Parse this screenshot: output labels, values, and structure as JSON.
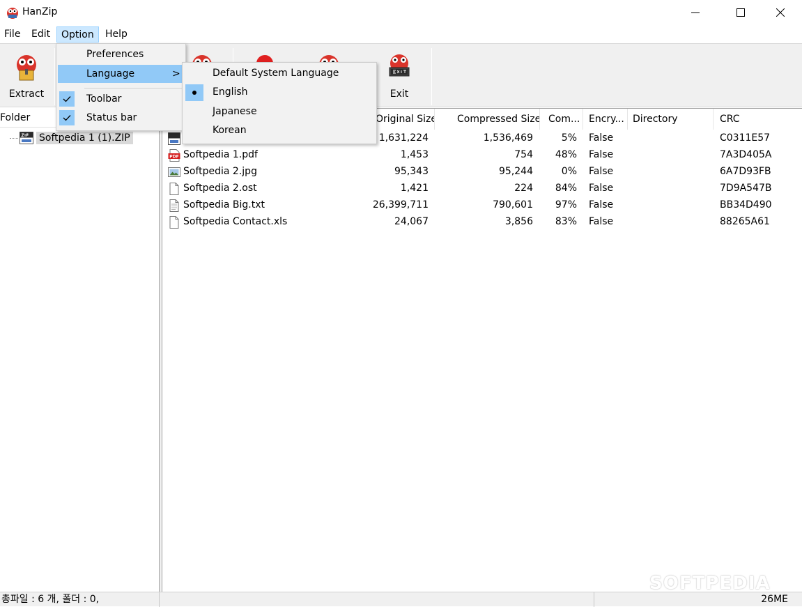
{
  "window": {
    "title": "HanZip",
    "minimize_glyph": "—",
    "maximize_glyph": "☐",
    "close_glyph": "✕"
  },
  "menubar": {
    "items": [
      {
        "label": "File"
      },
      {
        "label": "Edit"
      },
      {
        "label": "Option"
      },
      {
        "label": "Help"
      }
    ]
  },
  "toolbar": {
    "buttons": [
      {
        "label": "Extract",
        "icon": "extract-mascot-icon"
      },
      {
        "label": "",
        "icon": "mascot-icon"
      },
      {
        "label": "",
        "icon": "red-stop-icon"
      },
      {
        "label": "",
        "icon": "mascot-icon"
      },
      {
        "label": "Exit",
        "icon": "exit-mascot-icon"
      }
    ]
  },
  "option_menu": {
    "items": [
      {
        "label": "Preferences",
        "checked": false,
        "submenu": false
      },
      {
        "label": "Language",
        "checked": false,
        "submenu": true,
        "arrow": ">"
      },
      {
        "label": "Toolbar",
        "checked": true
      },
      {
        "label": "Status bar",
        "checked": true
      }
    ]
  },
  "language_submenu": {
    "items": [
      {
        "label": "Default System Language",
        "selected": false
      },
      {
        "label": "English",
        "selected": true
      },
      {
        "label": "Japanese",
        "selected": false
      },
      {
        "label": "Korean",
        "selected": false
      }
    ]
  },
  "left_panel": {
    "header": "Folder",
    "tree_item": "Softpedia 1 (1).ZIP"
  },
  "file_list": {
    "columns": [
      "Original Size",
      "Compressed Size",
      "Com...",
      "Encry...",
      "Directory",
      "CRC"
    ],
    "rows": [
      {
        "name": "",
        "icon": "zip-file-icon",
        "original": "1,631,224",
        "compressed": "1,536,469",
        "ratio": "5%",
        "encrypted": "False",
        "directory": "",
        "crc": "C0311E57"
      },
      {
        "name": "Softpedia 1.pdf",
        "icon": "pdf-file-icon",
        "original": "1,453",
        "compressed": "754",
        "ratio": "48%",
        "encrypted": "False",
        "directory": "",
        "crc": "7A3D405A"
      },
      {
        "name": "Softpedia 2.jpg",
        "icon": "image-file-icon",
        "original": "95,343",
        "compressed": "95,244",
        "ratio": "0%",
        "encrypted": "False",
        "directory": "",
        "crc": "6A7D93FB"
      },
      {
        "name": "Softpedia 2.ost",
        "icon": "blank-file-icon",
        "original": "1,421",
        "compressed": "224",
        "ratio": "84%",
        "encrypted": "False",
        "directory": "",
        "crc": "7D9A547B"
      },
      {
        "name": "Softpedia Big.txt",
        "icon": "text-file-icon",
        "original": "26,399,711",
        "compressed": "790,601",
        "ratio": "97%",
        "encrypted": "False",
        "directory": "",
        "crc": "BB34D490"
      },
      {
        "name": "Softpedia Contact.xls",
        "icon": "blank-file-icon",
        "original": "24,067",
        "compressed": "3,856",
        "ratio": "83%",
        "encrypted": "False",
        "directory": "",
        "crc": "88265A61"
      }
    ]
  },
  "statusbar": {
    "left": "총파일 : 6 개, 폴더 : 0,",
    "right": "26ME"
  },
  "watermark": "SOFTPEDIA",
  "colors": {
    "menu_highlight": "#91c9f7",
    "active_menu": "#cce8ff",
    "toolbar_bg": "#f0f0f0"
  }
}
